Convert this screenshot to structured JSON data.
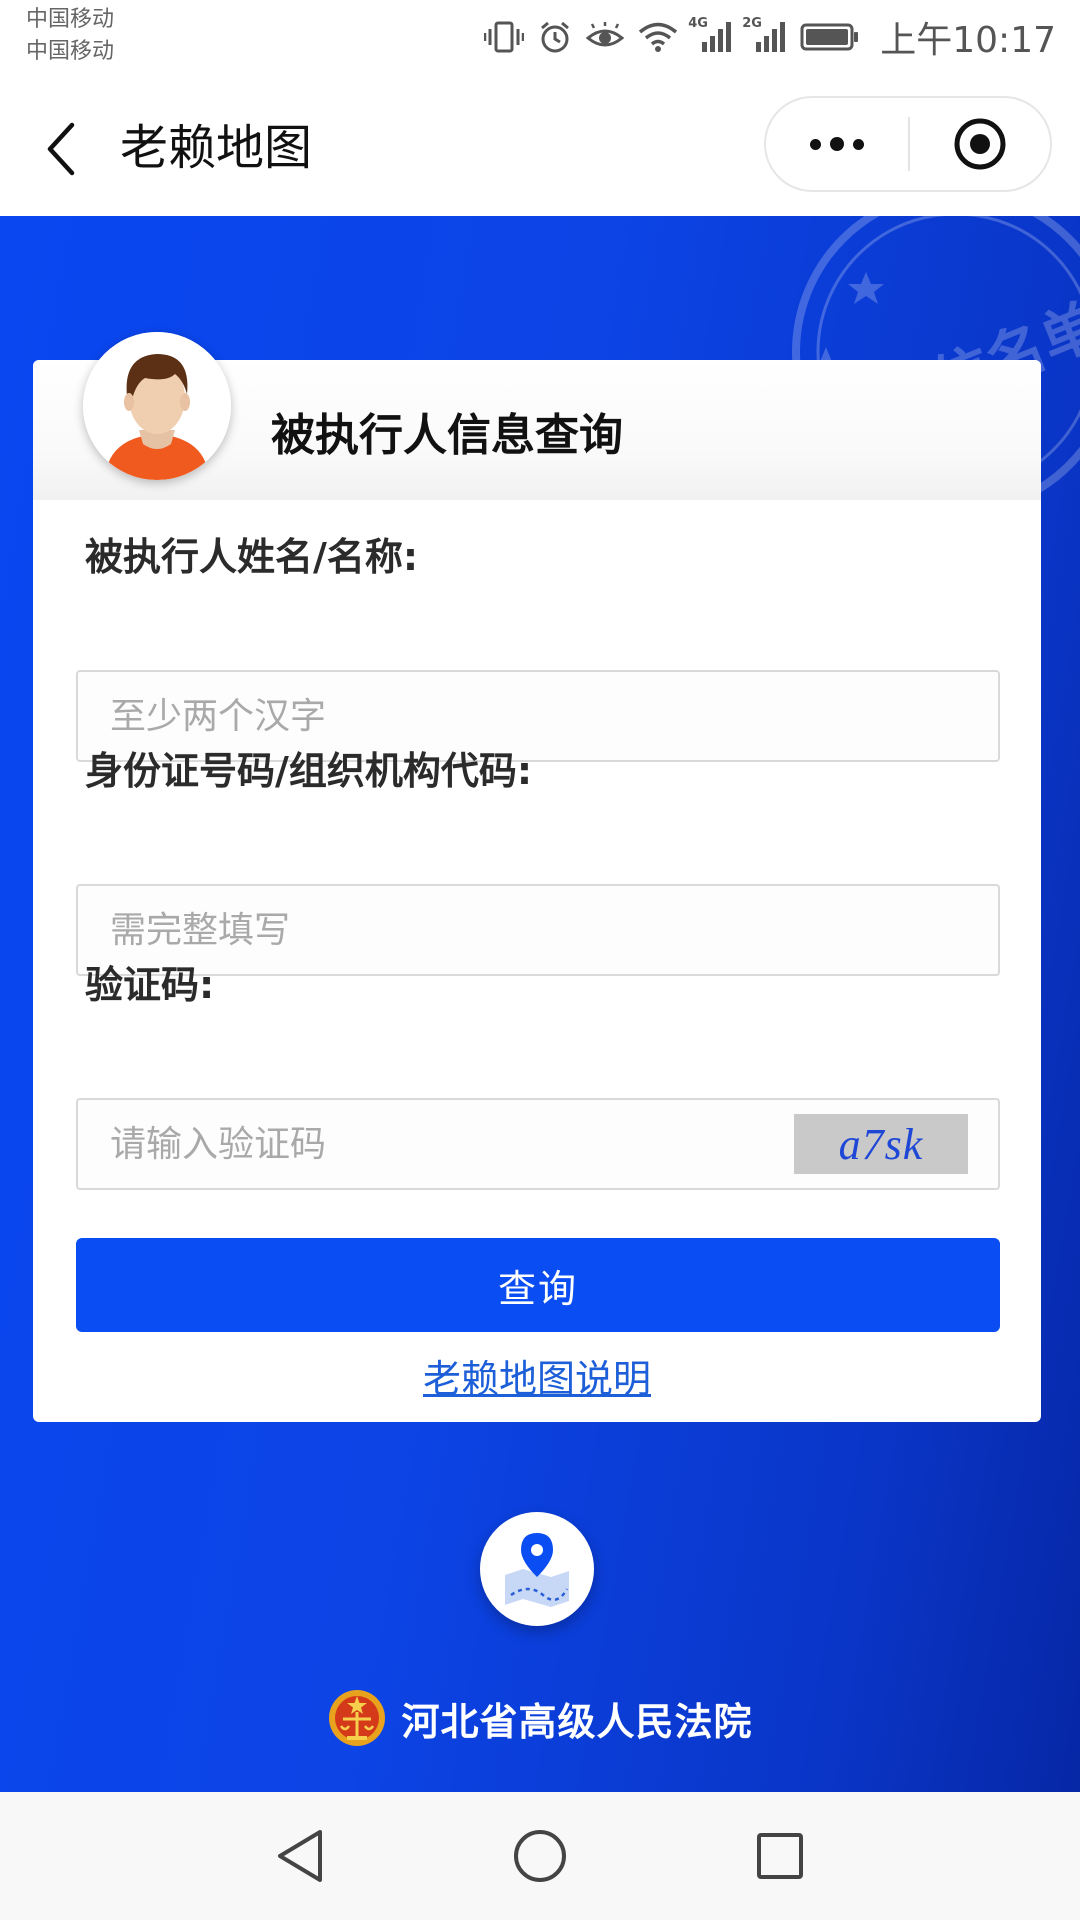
{
  "status_bar": {
    "carrier_1": "中国移动",
    "carrier_2": "中国移动",
    "network_1": "4G",
    "network_2": "2G",
    "time": "上午10:17",
    "icons": [
      "vibrate-icon",
      "alarm-icon",
      "eye-comfort-icon",
      "wifi-icon",
      "signal-icon",
      "signal-icon",
      "battery-icon"
    ]
  },
  "title_bar": {
    "title": "老赖地图",
    "back_icon": "chevron-left-icon",
    "more_icon": "more-dots-icon",
    "close_icon": "target-close-icon"
  },
  "background": {
    "stamp_text": "失信名单"
  },
  "card": {
    "title": "被执行人信息查询",
    "fields": [
      {
        "label": "被执行人姓名/名称:",
        "placeholder": "至少两个汉字",
        "value": ""
      },
      {
        "label": "身份证号码/组织机构代码:",
        "placeholder": "需完整填写",
        "value": ""
      },
      {
        "label": "验证码:",
        "placeholder": "请输入验证码",
        "value": ""
      }
    ],
    "captcha_text": "a7sk",
    "submit_label": "查询",
    "help_link": "老赖地图说明"
  },
  "footer": {
    "map_icon": "map-pin-icon",
    "court_name": "河北省高级人民法院"
  },
  "colors": {
    "brand_blue": "#0a4df2",
    "link_blue": "#1d5fd8",
    "background_blue": "#0c44e6"
  },
  "nav_bar": {
    "icons": [
      "back-triangle-icon",
      "home-circle-icon",
      "recents-square-icon"
    ]
  }
}
